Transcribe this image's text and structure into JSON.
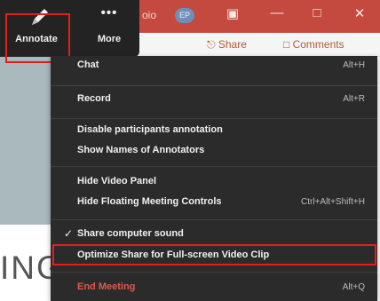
{
  "toolbar": {
    "annotate_label": "Annotate",
    "more_label": "More",
    "more_dots": "•••"
  },
  "window": {
    "title_fragment": "oio",
    "badge": "EP",
    "share_label": "Share",
    "comments_label": "Comments"
  },
  "menu": {
    "chat": {
      "label": "Chat",
      "shortcut": "Alt+H"
    },
    "record": {
      "label": "Record",
      "shortcut": "Alt+R"
    },
    "disable_annotation": {
      "label": "Disable participants annotation"
    },
    "show_names": {
      "label": "Show Names of Annotators"
    },
    "hide_video": {
      "label": "Hide Video Panel"
    },
    "hide_floating": {
      "label": "Hide Floating Meeting Controls",
      "shortcut": "Ctrl+Alt+Shift+H"
    },
    "share_sound": {
      "label": "Share computer sound",
      "checked": true
    },
    "optimize": {
      "label": "Optimize Share for Full-screen Video Clip"
    },
    "end_meeting": {
      "label": "End Meeting",
      "shortcut": "Alt+Q"
    }
  },
  "background_text": "ING",
  "colors": {
    "menu_bg": "#2b2b2b",
    "highlight": "#e0201a",
    "danger": "#e05a4b",
    "titlebar": "#c4493f"
  }
}
